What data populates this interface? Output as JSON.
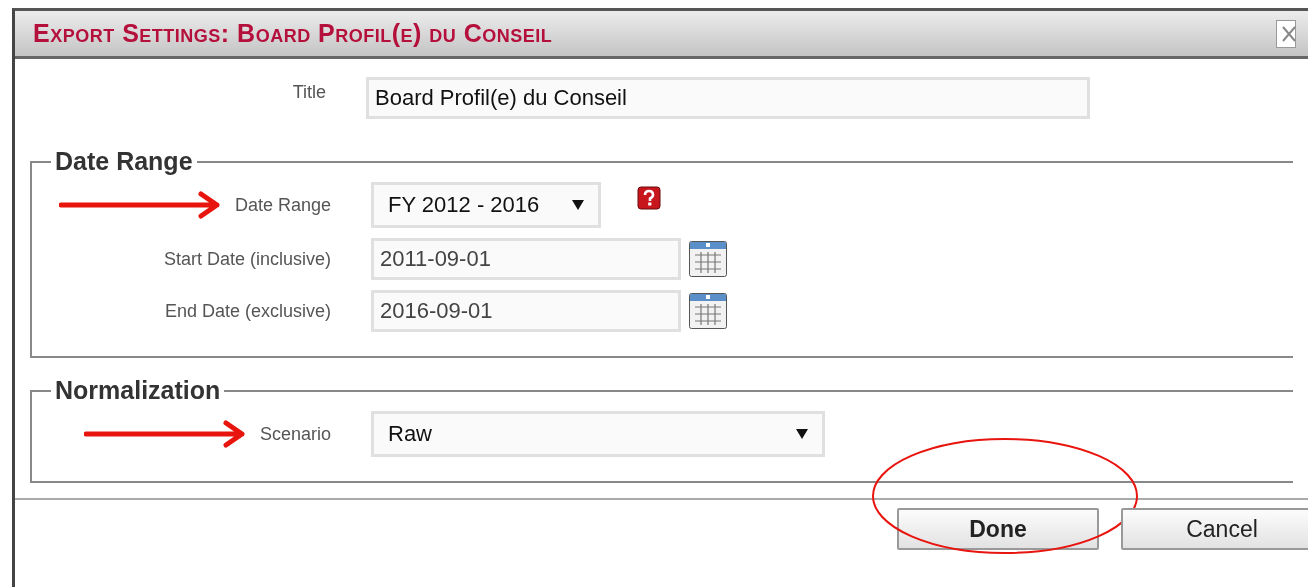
{
  "dialog": {
    "title": "Export Settings: Board Profil(e) du Conseil"
  },
  "title_field": {
    "label": "Title",
    "value": "Board Profil(e) du Conseil"
  },
  "sections": [
    {
      "legend": "Date Range",
      "rows": [
        {
          "kind": "period-select",
          "label": "Date Range",
          "value": "FY 2012 - 2016",
          "help": true,
          "annotated": true
        },
        {
          "kind": "date",
          "label": "Start Date (inclusive)",
          "value": "2011-09-01",
          "help": false,
          "annotated": false
        },
        {
          "kind": "date",
          "label": "End Date (exclusive)",
          "value": "2016-09-01",
          "help": false,
          "annotated": false
        }
      ]
    },
    {
      "legend": "Normalization",
      "rows": [
        {
          "kind": "select",
          "label": "Scenario",
          "value": "Raw",
          "help": false,
          "annotated": true
        }
      ]
    }
  ],
  "buttons": [
    {
      "label": "Done",
      "primary": true,
      "circled": true
    },
    {
      "label": "Cancel",
      "primary": false,
      "circled": false
    }
  ]
}
